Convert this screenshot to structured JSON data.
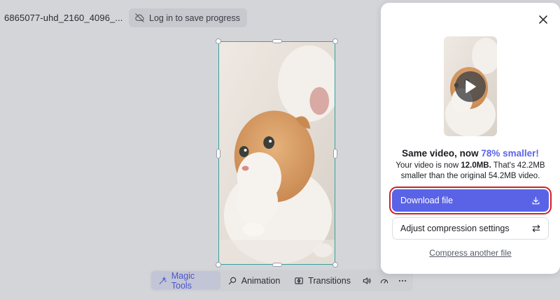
{
  "header": {
    "project_title": "6865077-uhd_2160_4096_...",
    "login_label": "Log in to save progress",
    "login_icon": "cloud-off-icon"
  },
  "toolbar": {
    "items": [
      {
        "label": "Magic Tools",
        "icon": "sparkle-wand-icon",
        "active": true
      },
      {
        "label": "Animation",
        "icon": "animation-icon",
        "active": false
      },
      {
        "label": "Transitions",
        "icon": "transitions-icon",
        "active": false
      }
    ],
    "icons": [
      "volume-icon",
      "speed-gauge-icon",
      "more-icon"
    ]
  },
  "panel": {
    "headline_prefix": "Same video, now ",
    "headline_accent": "78% smaller!",
    "sub_line1_pre": "Your video is now ",
    "sub_line1_bold": "12.0MB.",
    "sub_line1_post": " That's 42.2MB",
    "sub_line2": "smaller than the original 54.2MB video.",
    "download_label": "Download file",
    "adjust_label": "Adjust compression settings",
    "compress_link": "Compress another file"
  },
  "colors": {
    "accent": "#5a63e6",
    "accent_text": "#5b64e8",
    "highlight_outline": "#d11f26",
    "selection_border": "#3a9fa0",
    "background": "#d4d5d9"
  }
}
